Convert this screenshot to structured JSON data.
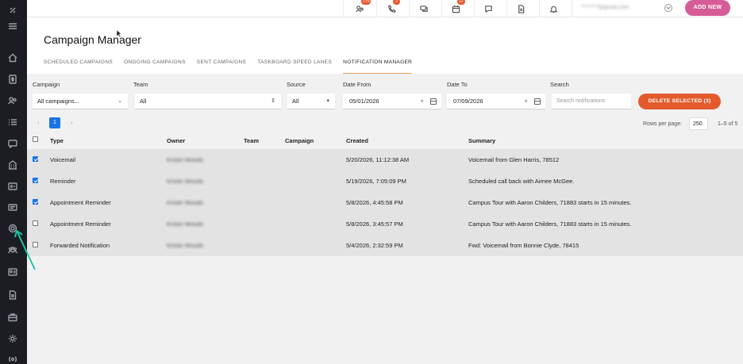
{
  "sidebar": {
    "icons": [
      "logo-icon",
      "menu-icon",
      "home-icon",
      "dollar-icon",
      "users-icon",
      "list-icon",
      "chat-icon",
      "building-icon",
      "id-card-icon",
      "message-icon",
      "target-icon",
      "group-icon",
      "contact-card-icon",
      "document-icon",
      "briefcase-icon",
      "settings-icon",
      "radio-icon"
    ]
  },
  "topbar": {
    "badges": {
      "users": "775",
      "phone": "2",
      "calendar": "12"
    },
    "email": "********@gmail.com",
    "add_new_label": "ADD NEW"
  },
  "page": {
    "title": "Campaign Manager",
    "tabs": [
      "SCHEDULED CAMPAIGNS",
      "ONGOING CAMPAIGNS",
      "SENT CAMPAIGNS",
      "TASKBOARD SPEED LANES",
      "NOTIFICATION MANAGER"
    ],
    "active_tab": "NOTIFICATION MANAGER"
  },
  "filters": {
    "campaign_label": "Campaign",
    "campaign_value": "All campaigns...",
    "team_label": "Team",
    "team_value": "All",
    "source_label": "Source",
    "source_value": "All",
    "date_from_label": "Date From",
    "date_from_value": "05/01/2026",
    "date_to_label": "Date To",
    "date_to_value": "07/09/2026",
    "search_label": "Search",
    "search_placeholder": "Search notifications",
    "delete_label": "DELETE SELECTED (3)"
  },
  "pagination": {
    "prev": "‹",
    "page": "1",
    "next": "›",
    "rows_per_page_label": "Rows per page:",
    "rows_per_page": "250",
    "range": "1–5 of 5"
  },
  "table": {
    "headers": {
      "type": "Type",
      "owner": "Owner",
      "team": "Team",
      "campaign": "Campaign",
      "created": "Created",
      "summary": "Summary"
    },
    "rows": [
      {
        "checked": true,
        "type": "Voicemail",
        "owner": "Kristin Woods",
        "created": "5/20/2026, 11:12:38 AM",
        "summary": "Voicemail from Glen Harris, 78512"
      },
      {
        "checked": true,
        "type": "Reminder",
        "owner": "Kristin Woods",
        "created": "5/19/2026, 7:05:09 PM",
        "summary": "Scheduled call back with Aimee McGee."
      },
      {
        "checked": true,
        "type": "Appointment Reminder",
        "owner": "Kristin Woods",
        "created": "5/8/2026, 4:45:58 PM",
        "summary": "Campus Tour with Aaron Childers, 71883 starts in 15 minutes."
      },
      {
        "checked": false,
        "type": "Appointment Reminder",
        "owner": "Kristin Woods",
        "created": "5/8/2026, 3:45:57 PM",
        "summary": "Campus Tour with Aaron Childers, 71883 starts in 15 minutes."
      },
      {
        "checked": false,
        "type": "Forwarded Notification",
        "owner": "Kristin Woods",
        "created": "5/4/2026, 2:32:59 PM",
        "summary": "Fwd: Voicemail from Bonnie Clyde, 78415"
      }
    ]
  },
  "colors": {
    "accent": "#e35b2c",
    "brand": "#d65c97",
    "primary": "#1a73e8",
    "sidebar": "#1b1d22",
    "annotation_arrow": "#1fc4a7"
  }
}
